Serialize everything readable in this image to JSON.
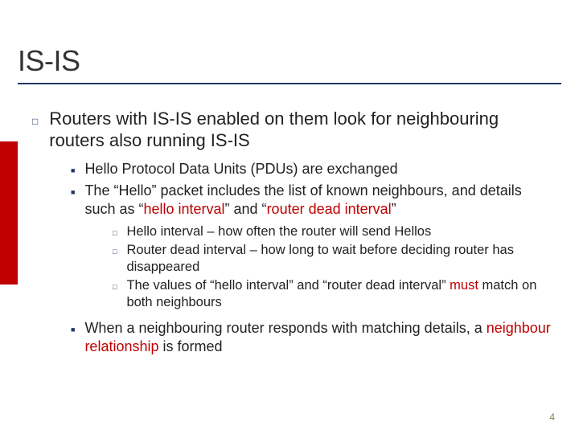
{
  "title": "IS-IS",
  "page_number": "4",
  "colors": {
    "accent": "#c00000",
    "rule": "#203864"
  },
  "body": {
    "p1": "Routers with IS-IS enabled on them look for neighbouring routers also running IS-IS",
    "s1": "Hello Protocol Data Units (PDUs) are exchanged",
    "s2a": "The “Hello” packet includes the list of known neighbours, and details such as “",
    "s2b": "hello interval",
    "s2c": "” and “",
    "s2d": "router dead interval",
    "s2e": "”",
    "t1": "Hello interval – how often the router will send Hellos",
    "t2": "Router dead interval – how long to wait before deciding router has disappeared",
    "t3a": "The values of “hello interval” and “router dead interval” ",
    "t3b": "must",
    "t3c": " match on both neighbours",
    "s3a": "When a neighbouring router responds with matching details, a ",
    "s3b": "neighbour relationship",
    "s3c": " is formed"
  }
}
